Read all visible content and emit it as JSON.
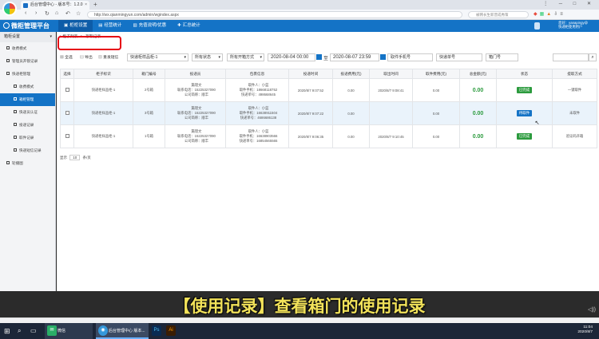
{
  "browser": {
    "tab_title": "后台管理中心 - 版本号：1.2.0",
    "tab_close": "×",
    "new_tab": "+",
    "url": "http://wx.qianmingyun.com/admin/wgindex.aspx",
    "search_placeholder": "被韩长生新晋成秀策",
    "window_controls": "⋮ ─ □ ✕"
  },
  "app": {
    "brand": "微柜管理平台",
    "nav": [
      {
        "label": "柜柜设置",
        "icon": "▣"
      },
      {
        "label": "经营统计",
        "icon": "▤"
      },
      {
        "label": "充值说明/优惠",
        "icon": "▥"
      },
      {
        "label": "汇总统计",
        "icon": "✚"
      }
    ],
    "user_line1": "您好：yanapingy@",
    "user_line2": "快递柜使用用户"
  },
  "sidebar": {
    "header": "箱柜设置",
    "items": [
      {
        "label": "收费模式",
        "sub": false,
        "active": false
      },
      {
        "label": "管理员开锁记录",
        "sub": false,
        "active": false
      },
      {
        "label": "快递柜管理",
        "sub": false,
        "active": false
      },
      {
        "label": "收费模式",
        "sub": true,
        "active": false
      },
      {
        "label": "箱柜管理",
        "sub": true,
        "active": true
      },
      {
        "label": "快递员认证",
        "sub": true,
        "active": false
      },
      {
        "label": "投递记录",
        "sub": true,
        "active": false
      },
      {
        "label": "取件记录",
        "sub": true,
        "active": false
      },
      {
        "label": "快递短信记录",
        "sub": true,
        "active": false
      },
      {
        "label": "轮播图",
        "sub": false,
        "active": false
      }
    ]
  },
  "breadcrumb": {
    "home": "柜子列表",
    "sep": ">",
    "current": "存取记录"
  },
  "toolbar": {
    "refresh": "全选",
    "export": "导出",
    "reset": "重发短信",
    "cabinet_select": "快递柜样品柜-1",
    "status_select": "所有状态",
    "method_select": "所有开箱方式",
    "date_from": "2020-08-04 00:00",
    "to": "至",
    "date_to": "2020-08-07 23:59",
    "pickup_phone": "取件手机号",
    "tracking_no": "快递单号",
    "door_no": "箱门号",
    "search_icon": "⌕"
  },
  "table": {
    "headers": [
      "选择",
      "柜子标识",
      "箱门编号",
      "投递员",
      "包裹信息",
      "投递时间",
      "投递费用(元)",
      "取出时间",
      "取件费用(元)",
      "总金额(元)",
      "状态",
      "提取方式"
    ],
    "rows": [
      {
        "cabinet": "快递柜样品柜-1",
        "door": "2号箱",
        "courier": [
          "篇理文",
          "联系电话：15225327090",
          "公司简称：顺丰"
        ],
        "package": [
          "取件人：小蓝",
          "取件手机：18668118752",
          "快递单号：498668645"
        ],
        "deliver_time": "2020/8/7 9:07:52",
        "deliver_fee": "0.00",
        "pickup_time": "2020/8/7 9:08:41",
        "pickup_fee": "0.00",
        "total": "0.00",
        "status": "已完成",
        "method": "一键取件",
        "highlight": false
      },
      {
        "cabinet": "快递柜样品柜-1",
        "door": "3号箱",
        "courier": [
          "篇理文",
          "联系电话：15225327090",
          "公司简称：顺丰"
        ],
        "package": [
          "取件人：小蓝",
          "取件手机：16638911504",
          "快递单号：4686686138"
        ],
        "deliver_time": "2020/8/7 9:07:22",
        "deliver_fee": "0.00",
        "pickup_time": "",
        "pickup_fee": "0.00",
        "total": "0.00",
        "status": "待取件",
        "method": "未取件",
        "highlight": true
      },
      {
        "cabinet": "快递柜样品柜-1",
        "door": "1号箱",
        "courier": [
          "篇理文",
          "联系电话：15225327090",
          "公司简称：顺丰"
        ],
        "package": [
          "取件人：小蓝",
          "取件手机：16638903566",
          "快递单号：16854565565"
        ],
        "deliver_time": "2020/8/7 9:06:35",
        "deliver_fee": "0.00",
        "pickup_time": "2020/8/7 9:10:45",
        "pickup_fee": "0.00",
        "total": "0.00",
        "status": "已完成",
        "method": "验证码开箱",
        "highlight": false
      }
    ]
  },
  "pager": {
    "label": "显示",
    "size": "10",
    "suffix": "条/页"
  },
  "colors": {
    "primary": "#1473c6",
    "done": "#2c9b3e",
    "waiting": "#1473c6",
    "highlight": "#e60012"
  },
  "caption": "【使用记录】查看箱门的使用记录",
  "taskbar": {
    "wechat": "微信",
    "browser": "后台管理中心 版本...",
    "time": "11:04",
    "date": "2020/8/7"
  }
}
